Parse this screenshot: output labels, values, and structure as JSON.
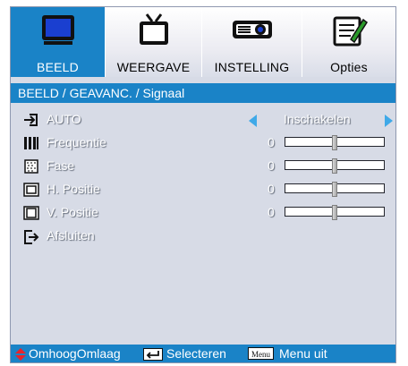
{
  "tabs": [
    {
      "label": "BEELD",
      "icon": "monitor-icon",
      "active": true
    },
    {
      "label": "WEERGAVE",
      "icon": "tv-icon",
      "active": false
    },
    {
      "label": "INSTELLING",
      "icon": "projector-icon",
      "active": false
    },
    {
      "label": "Opties",
      "icon": "notepad-icon",
      "active": false
    }
  ],
  "breadcrumb": "BEELD / GEAVANC. / Signaal",
  "items": [
    {
      "label": "AUTO",
      "icon": "auto-input-icon",
      "value": "Inschakelen"
    },
    {
      "label": "Frequentie",
      "icon": "frequency-icon",
      "value": "0",
      "level": 0.5
    },
    {
      "label": "Fase",
      "icon": "phase-icon",
      "value": "0",
      "level": 0.5
    },
    {
      "label": "H. Positie",
      "icon": "h-position-icon",
      "value": "0",
      "level": 0.5
    },
    {
      "label": "V. Positie",
      "icon": "v-position-icon",
      "value": "0",
      "level": 0.5
    },
    {
      "label": "Afsluiten",
      "icon": "exit-icon"
    }
  ],
  "footer": {
    "nav_label": "OmhoogOmlaag",
    "select_label": "Selecteren",
    "menu_key": "Menu",
    "menu_label": "Menu uit"
  },
  "colors": {
    "accent": "#1a83c7",
    "panel": "#d7dbe6",
    "arrow": "#3fa9e8",
    "nav_arrows": "#e8232a"
  }
}
